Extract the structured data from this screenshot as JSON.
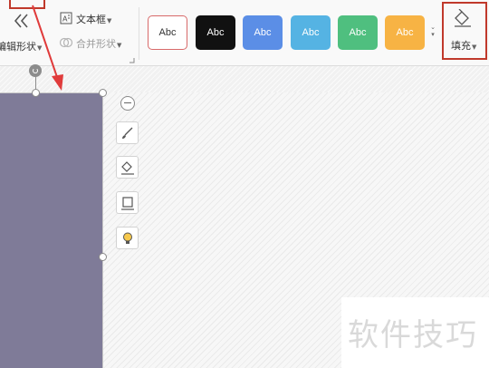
{
  "ribbon": {
    "edit_shape_label": "编辑形状",
    "textbox_label": "文本框",
    "merge_shape_label": "合并形状",
    "style_presets": [
      {
        "label": "Abc",
        "bg": "#ffffff",
        "fg": "#333333",
        "border": "#d86a6a"
      },
      {
        "label": "Abc",
        "bg": "#111111",
        "fg": "#ffffff",
        "border": "#111111"
      },
      {
        "label": "Abc",
        "bg": "#5b8ee6",
        "fg": "#ffffff",
        "border": "#5b8ee6"
      },
      {
        "label": "Abc",
        "bg": "#55b3e3",
        "fg": "#ffffff",
        "border": "#55b3e3"
      },
      {
        "label": "Abc",
        "bg": "#4fbf7f",
        "fg": "#ffffff",
        "border": "#4fbf7f"
      },
      {
        "label": "Abc",
        "bg": "#f7b344",
        "fg": "#ffffff",
        "border": "#f7b344"
      }
    ],
    "fill_label": "填充"
  },
  "shape": {
    "fill_color": "#7f7b98"
  },
  "annotation": {
    "color": "#c0392b"
  },
  "float_tools": [
    {
      "icon": "brush-icon"
    },
    {
      "icon": "fill-bucket-icon"
    },
    {
      "icon": "outline-frame-icon"
    },
    {
      "icon": "lightbulb-icon"
    }
  ],
  "watermark": {
    "text": "软件技巧"
  }
}
